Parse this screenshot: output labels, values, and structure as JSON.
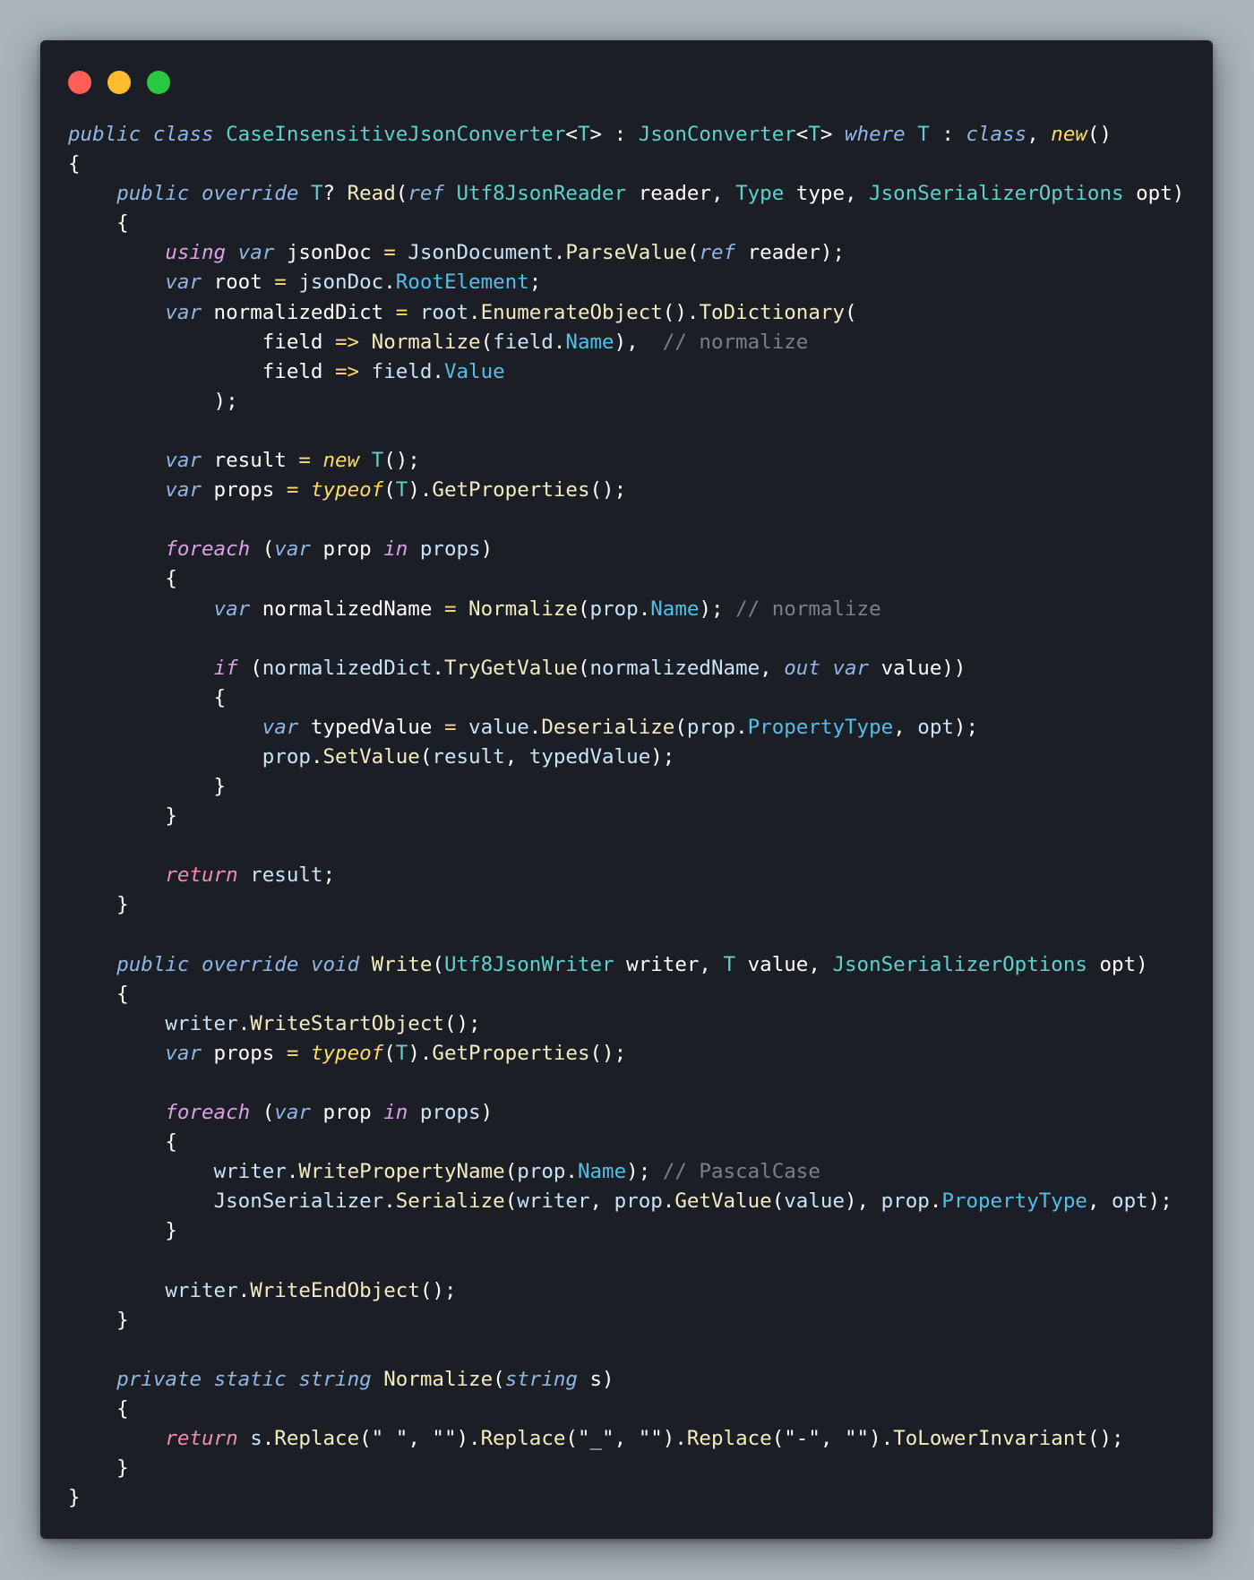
{
  "window": {
    "controls": [
      {
        "name": "close",
        "color": "#ff5f57"
      },
      {
        "name": "minimize",
        "color": "#febc2e"
      },
      {
        "name": "zoom",
        "color": "#28c840"
      }
    ]
  },
  "token_colors": {
    "keyword": "#8fb7e6",
    "control_keyword": "#dba1e6",
    "return_keyword": "#f08cac",
    "new_keyword": "#ffd866",
    "type": "#5ed1cd",
    "method": "#f3ecc0",
    "member": "#4fc1e9",
    "variable": "#c8e4f8",
    "plain": "#ffffff",
    "operator": "#ffdc73",
    "comment": "#7a7f8a"
  },
  "code": {
    "language": "C#",
    "lines": [
      [
        [
          "kw",
          "public"
        ],
        [
          "pl",
          " "
        ],
        [
          "kw",
          "class"
        ],
        [
          "pl",
          " "
        ],
        [
          "ty",
          "CaseInsensitiveJsonConverter"
        ],
        [
          "pl",
          "<"
        ],
        [
          "ty",
          "T"
        ],
        [
          "pl",
          "> : "
        ],
        [
          "ty",
          "JsonConverter"
        ],
        [
          "pl",
          "<"
        ],
        [
          "ty",
          "T"
        ],
        [
          "pl",
          "> "
        ],
        [
          "kw",
          "where"
        ],
        [
          "pl",
          " "
        ],
        [
          "ty",
          "T"
        ],
        [
          "pl",
          " : "
        ],
        [
          "kw",
          "class"
        ],
        [
          "pl",
          ", "
        ],
        [
          "kn",
          "new"
        ],
        [
          "pl",
          "()"
        ]
      ],
      [
        [
          "pl",
          "{"
        ]
      ],
      [
        [
          "pl",
          "    "
        ],
        [
          "kw",
          "public"
        ],
        [
          "pl",
          " "
        ],
        [
          "kw",
          "override"
        ],
        [
          "pl",
          " "
        ],
        [
          "ty",
          "T"
        ],
        [
          "pl",
          "? "
        ],
        [
          "fn",
          "Read"
        ],
        [
          "pl",
          "("
        ],
        [
          "kw",
          "ref"
        ],
        [
          "pl",
          " "
        ],
        [
          "ty",
          "Utf8JsonReader"
        ],
        [
          "pl",
          " reader, "
        ],
        [
          "ty",
          "Type"
        ],
        [
          "pl",
          " type, "
        ],
        [
          "ty",
          "JsonSerializerOptions"
        ],
        [
          "pl",
          " opt)"
        ]
      ],
      [
        [
          "pl",
          "    {"
        ]
      ],
      [
        [
          "pl",
          "        "
        ],
        [
          "kp",
          "using"
        ],
        [
          "pl",
          " "
        ],
        [
          "kw",
          "var"
        ],
        [
          "pl",
          " jsonDoc "
        ],
        [
          "op",
          "="
        ],
        [
          "pl",
          " "
        ],
        [
          "vr",
          "JsonDocument"
        ],
        [
          "pl",
          "."
        ],
        [
          "fn",
          "ParseValue"
        ],
        [
          "pl",
          "("
        ],
        [
          "kw",
          "ref"
        ],
        [
          "pl",
          " reader);"
        ]
      ],
      [
        [
          "pl",
          "        "
        ],
        [
          "kw",
          "var"
        ],
        [
          "pl",
          " root "
        ],
        [
          "op",
          "="
        ],
        [
          "pl",
          " "
        ],
        [
          "vr",
          "jsonDoc"
        ],
        [
          "pl",
          "."
        ],
        [
          "mb",
          "RootElement"
        ],
        [
          "pl",
          ";"
        ]
      ],
      [
        [
          "pl",
          "        "
        ],
        [
          "kw",
          "var"
        ],
        [
          "pl",
          " normalizedDict "
        ],
        [
          "op",
          "="
        ],
        [
          "pl",
          " "
        ],
        [
          "vr",
          "root"
        ],
        [
          "pl",
          "."
        ],
        [
          "fn",
          "EnumerateObject"
        ],
        [
          "pl",
          "()."
        ],
        [
          "fn",
          "ToDictionary"
        ],
        [
          "pl",
          "("
        ]
      ],
      [
        [
          "pl",
          "                field "
        ],
        [
          "op",
          "=>"
        ],
        [
          "pl",
          " "
        ],
        [
          "fn",
          "Normalize"
        ],
        [
          "pl",
          "("
        ],
        [
          "vr",
          "field"
        ],
        [
          "pl",
          "."
        ],
        [
          "mb",
          "Name"
        ],
        [
          "pl",
          "),  "
        ],
        [
          "cm",
          "// normalize"
        ]
      ],
      [
        [
          "pl",
          "                field "
        ],
        [
          "op",
          "=>"
        ],
        [
          "pl",
          " "
        ],
        [
          "vr",
          "field"
        ],
        [
          "pl",
          "."
        ],
        [
          "mb",
          "Value"
        ]
      ],
      [
        [
          "pl",
          "            );"
        ]
      ],
      [
        [
          "pl",
          ""
        ]
      ],
      [
        [
          "pl",
          "        "
        ],
        [
          "kw",
          "var"
        ],
        [
          "pl",
          " result "
        ],
        [
          "op",
          "="
        ],
        [
          "pl",
          " "
        ],
        [
          "kn",
          "new"
        ],
        [
          "pl",
          " "
        ],
        [
          "ty",
          "T"
        ],
        [
          "pl",
          "();"
        ]
      ],
      [
        [
          "pl",
          "        "
        ],
        [
          "kw",
          "var"
        ],
        [
          "pl",
          " props "
        ],
        [
          "op",
          "="
        ],
        [
          "pl",
          " "
        ],
        [
          "kn",
          "typeof"
        ],
        [
          "pl",
          "("
        ],
        [
          "ty",
          "T"
        ],
        [
          "pl",
          ")."
        ],
        [
          "fn",
          "GetProperties"
        ],
        [
          "pl",
          "();"
        ]
      ],
      [
        [
          "pl",
          ""
        ]
      ],
      [
        [
          "pl",
          "        "
        ],
        [
          "kp",
          "foreach"
        ],
        [
          "pl",
          " ("
        ],
        [
          "kw",
          "var"
        ],
        [
          "pl",
          " prop "
        ],
        [
          "kp",
          "in"
        ],
        [
          "pl",
          " "
        ],
        [
          "vr",
          "props"
        ],
        [
          "pl",
          ")"
        ]
      ],
      [
        [
          "pl",
          "        {"
        ]
      ],
      [
        [
          "pl",
          "            "
        ],
        [
          "kw",
          "var"
        ],
        [
          "pl",
          " normalizedName "
        ],
        [
          "op",
          "="
        ],
        [
          "pl",
          " "
        ],
        [
          "fn",
          "Normalize"
        ],
        [
          "pl",
          "("
        ],
        [
          "vr",
          "prop"
        ],
        [
          "pl",
          "."
        ],
        [
          "mb",
          "Name"
        ],
        [
          "pl",
          "); "
        ],
        [
          "cm",
          "// normalize"
        ]
      ],
      [
        [
          "pl",
          ""
        ]
      ],
      [
        [
          "pl",
          "            "
        ],
        [
          "kp",
          "if"
        ],
        [
          "pl",
          " ("
        ],
        [
          "vr",
          "normalizedDict"
        ],
        [
          "pl",
          "."
        ],
        [
          "fn",
          "TryGetValue"
        ],
        [
          "pl",
          "("
        ],
        [
          "vr",
          "normalizedName"
        ],
        [
          "pl",
          ", "
        ],
        [
          "kw",
          "out"
        ],
        [
          "pl",
          " "
        ],
        [
          "kw",
          "var"
        ],
        [
          "pl",
          " value))"
        ]
      ],
      [
        [
          "pl",
          "            {"
        ]
      ],
      [
        [
          "pl",
          "                "
        ],
        [
          "kw",
          "var"
        ],
        [
          "pl",
          " typedValue "
        ],
        [
          "op",
          "="
        ],
        [
          "pl",
          " "
        ],
        [
          "vr",
          "value"
        ],
        [
          "pl",
          "."
        ],
        [
          "fn",
          "Deserialize"
        ],
        [
          "pl",
          "("
        ],
        [
          "vr",
          "prop"
        ],
        [
          "pl",
          "."
        ],
        [
          "mb",
          "PropertyType"
        ],
        [
          "pl",
          ", "
        ],
        [
          "vr",
          "opt"
        ],
        [
          "pl",
          ");"
        ]
      ],
      [
        [
          "pl",
          "                "
        ],
        [
          "vr",
          "prop"
        ],
        [
          "pl",
          "."
        ],
        [
          "fn",
          "SetValue"
        ],
        [
          "pl",
          "("
        ],
        [
          "vr",
          "result"
        ],
        [
          "pl",
          ", "
        ],
        [
          "vr",
          "typedValue"
        ],
        [
          "pl",
          ");"
        ]
      ],
      [
        [
          "pl",
          "            }"
        ]
      ],
      [
        [
          "pl",
          "        }"
        ]
      ],
      [
        [
          "pl",
          ""
        ]
      ],
      [
        [
          "pl",
          "        "
        ],
        [
          "kr",
          "return"
        ],
        [
          "pl",
          " "
        ],
        [
          "vr",
          "result"
        ],
        [
          "pl",
          ";"
        ]
      ],
      [
        [
          "pl",
          "    }"
        ]
      ],
      [
        [
          "pl",
          ""
        ]
      ],
      [
        [
          "pl",
          "    "
        ],
        [
          "kw",
          "public"
        ],
        [
          "pl",
          " "
        ],
        [
          "kw",
          "override"
        ],
        [
          "pl",
          " "
        ],
        [
          "kw",
          "void"
        ],
        [
          "pl",
          " "
        ],
        [
          "fn",
          "Write"
        ],
        [
          "pl",
          "("
        ],
        [
          "ty",
          "Utf8JsonWriter"
        ],
        [
          "pl",
          " writer, "
        ],
        [
          "ty",
          "T"
        ],
        [
          "pl",
          " value, "
        ],
        [
          "ty",
          "JsonSerializerOptions"
        ],
        [
          "pl",
          " opt)"
        ]
      ],
      [
        [
          "pl",
          "    {"
        ]
      ],
      [
        [
          "pl",
          "        "
        ],
        [
          "vr",
          "writer"
        ],
        [
          "pl",
          "."
        ],
        [
          "fn",
          "WriteStartObject"
        ],
        [
          "pl",
          "();"
        ]
      ],
      [
        [
          "pl",
          "        "
        ],
        [
          "kw",
          "var"
        ],
        [
          "pl",
          " props "
        ],
        [
          "op",
          "="
        ],
        [
          "pl",
          " "
        ],
        [
          "kn",
          "typeof"
        ],
        [
          "pl",
          "("
        ],
        [
          "ty",
          "T"
        ],
        [
          "pl",
          ")."
        ],
        [
          "fn",
          "GetProperties"
        ],
        [
          "pl",
          "();"
        ]
      ],
      [
        [
          "pl",
          ""
        ]
      ],
      [
        [
          "pl",
          "        "
        ],
        [
          "kp",
          "foreach"
        ],
        [
          "pl",
          " ("
        ],
        [
          "kw",
          "var"
        ],
        [
          "pl",
          " prop "
        ],
        [
          "kp",
          "in"
        ],
        [
          "pl",
          " "
        ],
        [
          "vr",
          "props"
        ],
        [
          "pl",
          ")"
        ]
      ],
      [
        [
          "pl",
          "        {"
        ]
      ],
      [
        [
          "pl",
          "            "
        ],
        [
          "vr",
          "writer"
        ],
        [
          "pl",
          "."
        ],
        [
          "fn",
          "WritePropertyName"
        ],
        [
          "pl",
          "("
        ],
        [
          "vr",
          "prop"
        ],
        [
          "pl",
          "."
        ],
        [
          "mb",
          "Name"
        ],
        [
          "pl",
          "); "
        ],
        [
          "cm",
          "// PascalCase"
        ]
      ],
      [
        [
          "pl",
          "            "
        ],
        [
          "vr",
          "JsonSerializer"
        ],
        [
          "pl",
          "."
        ],
        [
          "fn",
          "Serialize"
        ],
        [
          "pl",
          "("
        ],
        [
          "vr",
          "writer"
        ],
        [
          "pl",
          ", "
        ],
        [
          "vr",
          "prop"
        ],
        [
          "pl",
          "."
        ],
        [
          "fn",
          "GetValue"
        ],
        [
          "pl",
          "("
        ],
        [
          "vr",
          "value"
        ],
        [
          "pl",
          "), "
        ],
        [
          "vr",
          "prop"
        ],
        [
          "pl",
          "."
        ],
        [
          "mb",
          "PropertyType"
        ],
        [
          "pl",
          ", "
        ],
        [
          "vr",
          "opt"
        ],
        [
          "pl",
          ");"
        ]
      ],
      [
        [
          "pl",
          "        }"
        ]
      ],
      [
        [
          "pl",
          ""
        ]
      ],
      [
        [
          "pl",
          "        "
        ],
        [
          "vr",
          "writer"
        ],
        [
          "pl",
          "."
        ],
        [
          "fn",
          "WriteEndObject"
        ],
        [
          "pl",
          "();"
        ]
      ],
      [
        [
          "pl",
          "    }"
        ]
      ],
      [
        [
          "pl",
          ""
        ]
      ],
      [
        [
          "pl",
          "    "
        ],
        [
          "kw",
          "private"
        ],
        [
          "pl",
          " "
        ],
        [
          "kw",
          "static"
        ],
        [
          "pl",
          " "
        ],
        [
          "kw",
          "string"
        ],
        [
          "pl",
          " "
        ],
        [
          "fn",
          "Normalize"
        ],
        [
          "pl",
          "("
        ],
        [
          "kw",
          "string"
        ],
        [
          "pl",
          " s)"
        ]
      ],
      [
        [
          "pl",
          "    {"
        ]
      ],
      [
        [
          "pl",
          "        "
        ],
        [
          "kr",
          "return"
        ],
        [
          "pl",
          " "
        ],
        [
          "vr",
          "s"
        ],
        [
          "pl",
          "."
        ],
        [
          "fn",
          "Replace"
        ],
        [
          "pl",
          "("
        ],
        [
          "st",
          "\" \""
        ],
        [
          "pl",
          ", "
        ],
        [
          "st",
          "\"\""
        ],
        [
          "pl",
          ")."
        ],
        [
          "fn",
          "Replace"
        ],
        [
          "pl",
          "("
        ],
        [
          "st",
          "\"_\""
        ],
        [
          "pl",
          ", "
        ],
        [
          "st",
          "\"\""
        ],
        [
          "pl",
          ")."
        ],
        [
          "fn",
          "Replace"
        ],
        [
          "pl",
          "("
        ],
        [
          "st",
          "\"-\""
        ],
        [
          "pl",
          ", "
        ],
        [
          "st",
          "\"\""
        ],
        [
          "pl",
          ")."
        ],
        [
          "fn",
          "ToLowerInvariant"
        ],
        [
          "pl",
          "();"
        ]
      ],
      [
        [
          "pl",
          "    }"
        ]
      ],
      [
        [
          "pl",
          "}"
        ]
      ]
    ]
  }
}
